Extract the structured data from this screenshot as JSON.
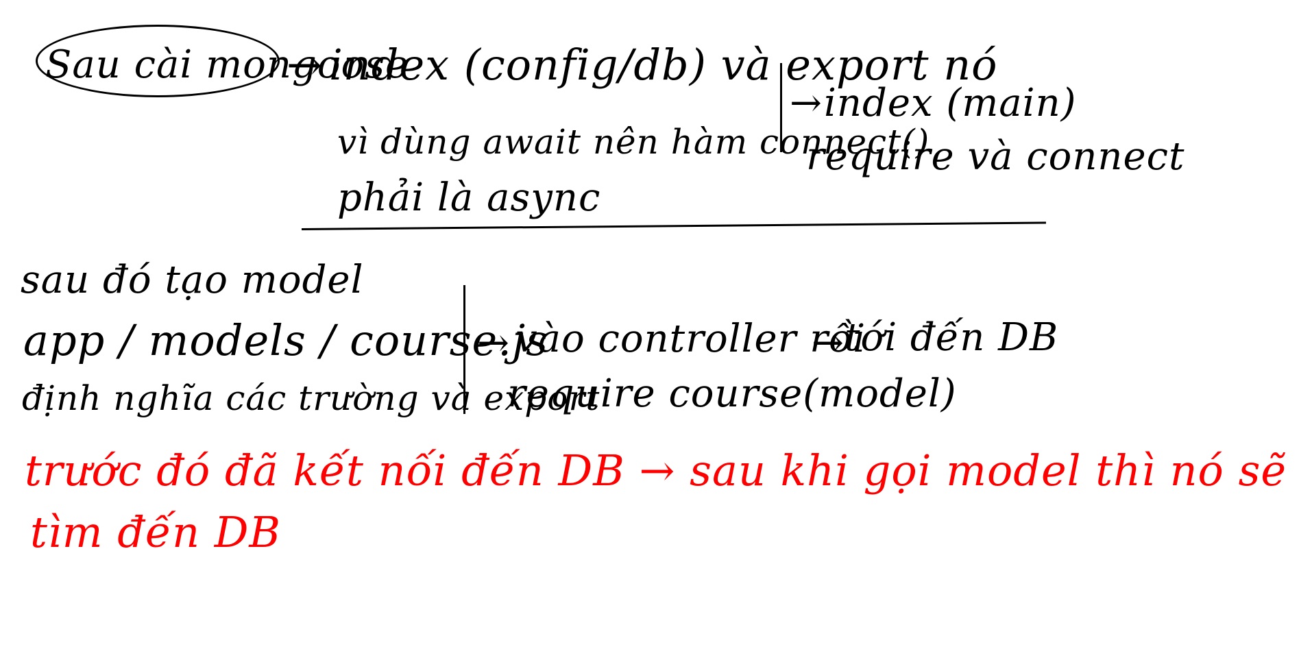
{
  "colors": {
    "background": "#ffffff",
    "ink": "#000000",
    "highlight": "#ff0000"
  },
  "notes": {
    "top": {
      "circled": "Sau cài mongoose",
      "arrow_1": "→",
      "config": "index (config/db) và export nó",
      "await_note": "vì dùng await nên hàm connect()",
      "async_note": "phải là async",
      "arrow_2": "→",
      "main": "index (main)",
      "require_connect": "require và connect"
    },
    "bottom": {
      "create_model": "sau đó tạo model",
      "model_path": "app / models / course.js",
      "define": "định nghĩa các trường và export",
      "arrow_3": "→",
      "controller": "vào controller rồi",
      "arrow_4": "→",
      "to_db": "tới đến DB",
      "require_course": "require course(model)"
    },
    "red": {
      "line_1": "trước đó đã kết nối đến DB → sau khi gọi model thì nó sẽ",
      "line_2": "tìm đến DB"
    }
  }
}
